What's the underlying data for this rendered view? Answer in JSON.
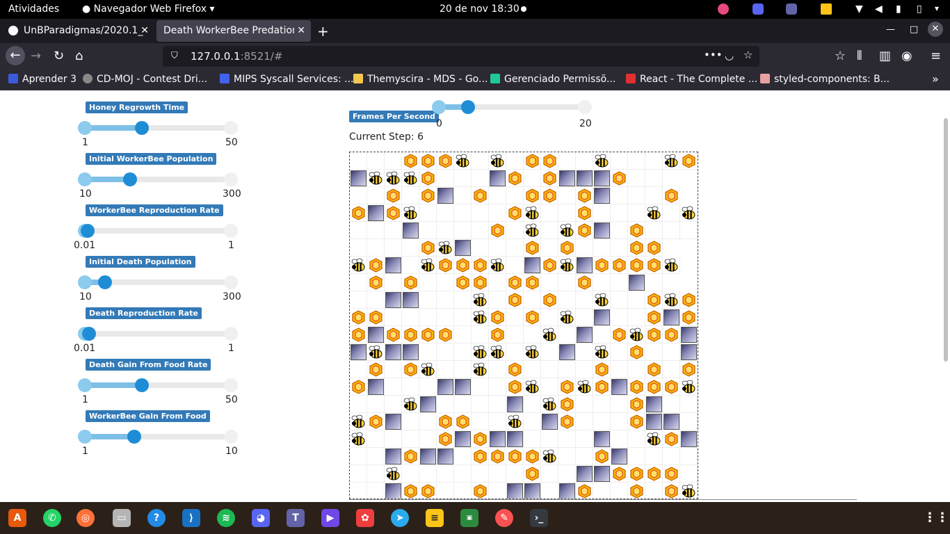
{
  "system": {
    "activities": "Atividades",
    "app_menu": "Navegador Web Firefox",
    "clock": "20 de nov  18:30"
  },
  "tabs": [
    {
      "title": "UnBParadigmas/2020.1_"
    },
    {
      "title": "Death WorkerBee Predation"
    }
  ],
  "navbar": {
    "url_host": "127.0.0.1",
    "url_rest": ":8521/#"
  },
  "bookmarks": [
    {
      "label": "Aprender 3",
      "color": "#3b5bdb"
    },
    {
      "label": "CD-MOJ - Contest Dri...",
      "color": "#888888"
    },
    {
      "label": "MIPS Syscall Services: ...",
      "color": "#4263eb"
    },
    {
      "label": "Themyscira - MDS - Go...",
      "color": "#f2c94c"
    },
    {
      "label": "Gerenciado Permissõ...",
      "color": "#20c997"
    },
    {
      "label": "React - The Complete ...",
      "color": "#e03131"
    },
    {
      "label": "styled-components: B...",
      "color": "#e8a0a0"
    }
  ],
  "sliders": [
    {
      "label": "Honey Regrowth Time",
      "min": "1",
      "max": "50",
      "value_fraction": 0.39
    },
    {
      "label": "Initial WorkerBee Population",
      "min": "10",
      "max": "300",
      "value_fraction": 0.31
    },
    {
      "label": "WorkerBee Reproduction Rate",
      "min": "0.01",
      "max": "1",
      "value_fraction": 0.02
    },
    {
      "label": "Initial Death Population",
      "min": "10",
      "max": "300",
      "value_fraction": 0.14
    },
    {
      "label": "Death Reproduction Rate",
      "min": "0.01",
      "max": "1",
      "value_fraction": 0.03
    },
    {
      "label": "Death Gain From Food Rate",
      "min": "1",
      "max": "50",
      "value_fraction": 0.39
    },
    {
      "label": "WorkerBee Gain From Food",
      "min": "1",
      "max": "10",
      "value_fraction": 0.34
    }
  ],
  "fps": {
    "label": "Frames Per Second",
    "min": "0",
    "max": "20",
    "value_fraction": 0.2
  },
  "step": {
    "label": "Current Step: 6"
  },
  "grid": {
    "cols": 20,
    "visible_rows": 20,
    "rows": [
      "...HHHB.B.HH..B...BHB",
      "DBBBH...DH.HDDDH..",
      "..H.HD.H..HH.HD...H",
      "HDHB.....HB..H...B.B",
      "...D....H.B.BHD.H...H",
      "....HBD...H.H...HH",
      "BHD.BHHHB.DHBDHHHHB",
      ".H.H..HH.HH..H..D.",
      "..DD...B.H.H..B..HBHB",
      "HH.....BH.H.B.D..HDH",
      "HDHHHH..H..B.D.HBHHDH",
      "DBDD...BB.B.D.B.H..D.",
      ".H.HB..B.H....H..H.H",
      "HD...DD..HB.HBHDHHHB",
      "...BD....D.BH...HD..D",
      "BHD..HH..B.DH...HDD.D",
      "B....HDHDD....D..BHD",
      "..DHDD.HHHHB..HD.....",
      "..B.......H..DDHHHH.H",
      "..DHH..H.DD.DH..H.HB.D"
    ]
  }
}
